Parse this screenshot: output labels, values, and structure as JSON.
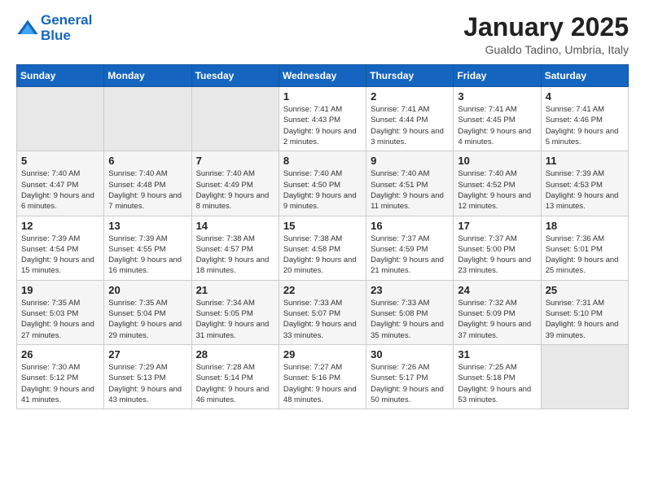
{
  "header": {
    "logo_line1": "General",
    "logo_line2": "Blue",
    "month_title": "January 2025",
    "subtitle": "Gualdo Tadino, Umbria, Italy"
  },
  "weekdays": [
    "Sunday",
    "Monday",
    "Tuesday",
    "Wednesday",
    "Thursday",
    "Friday",
    "Saturday"
  ],
  "weeks": [
    [
      {
        "day": "",
        "sunrise": "",
        "sunset": "",
        "daylight": "",
        "empty": true
      },
      {
        "day": "",
        "sunrise": "",
        "sunset": "",
        "daylight": "",
        "empty": true
      },
      {
        "day": "",
        "sunrise": "",
        "sunset": "",
        "daylight": "",
        "empty": true
      },
      {
        "day": "1",
        "sunrise": "Sunrise: 7:41 AM",
        "sunset": "Sunset: 4:43 PM",
        "daylight": "Daylight: 9 hours and 2 minutes."
      },
      {
        "day": "2",
        "sunrise": "Sunrise: 7:41 AM",
        "sunset": "Sunset: 4:44 PM",
        "daylight": "Daylight: 9 hours and 3 minutes."
      },
      {
        "day": "3",
        "sunrise": "Sunrise: 7:41 AM",
        "sunset": "Sunset: 4:45 PM",
        "daylight": "Daylight: 9 hours and 4 minutes."
      },
      {
        "day": "4",
        "sunrise": "Sunrise: 7:41 AM",
        "sunset": "Sunset: 4:46 PM",
        "daylight": "Daylight: 9 hours and 5 minutes."
      }
    ],
    [
      {
        "day": "5",
        "sunrise": "Sunrise: 7:40 AM",
        "sunset": "Sunset: 4:47 PM",
        "daylight": "Daylight: 9 hours and 6 minutes."
      },
      {
        "day": "6",
        "sunrise": "Sunrise: 7:40 AM",
        "sunset": "Sunset: 4:48 PM",
        "daylight": "Daylight: 9 hours and 7 minutes."
      },
      {
        "day": "7",
        "sunrise": "Sunrise: 7:40 AM",
        "sunset": "Sunset: 4:49 PM",
        "daylight": "Daylight: 9 hours and 8 minutes."
      },
      {
        "day": "8",
        "sunrise": "Sunrise: 7:40 AM",
        "sunset": "Sunset: 4:50 PM",
        "daylight": "Daylight: 9 hours and 9 minutes."
      },
      {
        "day": "9",
        "sunrise": "Sunrise: 7:40 AM",
        "sunset": "Sunset: 4:51 PM",
        "daylight": "Daylight: 9 hours and 11 minutes."
      },
      {
        "day": "10",
        "sunrise": "Sunrise: 7:40 AM",
        "sunset": "Sunset: 4:52 PM",
        "daylight": "Daylight: 9 hours and 12 minutes."
      },
      {
        "day": "11",
        "sunrise": "Sunrise: 7:39 AM",
        "sunset": "Sunset: 4:53 PM",
        "daylight": "Daylight: 9 hours and 13 minutes."
      }
    ],
    [
      {
        "day": "12",
        "sunrise": "Sunrise: 7:39 AM",
        "sunset": "Sunset: 4:54 PM",
        "daylight": "Daylight: 9 hours and 15 minutes."
      },
      {
        "day": "13",
        "sunrise": "Sunrise: 7:39 AM",
        "sunset": "Sunset: 4:55 PM",
        "daylight": "Daylight: 9 hours and 16 minutes."
      },
      {
        "day": "14",
        "sunrise": "Sunrise: 7:38 AM",
        "sunset": "Sunset: 4:57 PM",
        "daylight": "Daylight: 9 hours and 18 minutes."
      },
      {
        "day": "15",
        "sunrise": "Sunrise: 7:38 AM",
        "sunset": "Sunset: 4:58 PM",
        "daylight": "Daylight: 9 hours and 20 minutes."
      },
      {
        "day": "16",
        "sunrise": "Sunrise: 7:37 AM",
        "sunset": "Sunset: 4:59 PM",
        "daylight": "Daylight: 9 hours and 21 minutes."
      },
      {
        "day": "17",
        "sunrise": "Sunrise: 7:37 AM",
        "sunset": "Sunset: 5:00 PM",
        "daylight": "Daylight: 9 hours and 23 minutes."
      },
      {
        "day": "18",
        "sunrise": "Sunrise: 7:36 AM",
        "sunset": "Sunset: 5:01 PM",
        "daylight": "Daylight: 9 hours and 25 minutes."
      }
    ],
    [
      {
        "day": "19",
        "sunrise": "Sunrise: 7:35 AM",
        "sunset": "Sunset: 5:03 PM",
        "daylight": "Daylight: 9 hours and 27 minutes."
      },
      {
        "day": "20",
        "sunrise": "Sunrise: 7:35 AM",
        "sunset": "Sunset: 5:04 PM",
        "daylight": "Daylight: 9 hours and 29 minutes."
      },
      {
        "day": "21",
        "sunrise": "Sunrise: 7:34 AM",
        "sunset": "Sunset: 5:05 PM",
        "daylight": "Daylight: 9 hours and 31 minutes."
      },
      {
        "day": "22",
        "sunrise": "Sunrise: 7:33 AM",
        "sunset": "Sunset: 5:07 PM",
        "daylight": "Daylight: 9 hours and 33 minutes."
      },
      {
        "day": "23",
        "sunrise": "Sunrise: 7:33 AM",
        "sunset": "Sunset: 5:08 PM",
        "daylight": "Daylight: 9 hours and 35 minutes."
      },
      {
        "day": "24",
        "sunrise": "Sunrise: 7:32 AM",
        "sunset": "Sunset: 5:09 PM",
        "daylight": "Daylight: 9 hours and 37 minutes."
      },
      {
        "day": "25",
        "sunrise": "Sunrise: 7:31 AM",
        "sunset": "Sunset: 5:10 PM",
        "daylight": "Daylight: 9 hours and 39 minutes."
      }
    ],
    [
      {
        "day": "26",
        "sunrise": "Sunrise: 7:30 AM",
        "sunset": "Sunset: 5:12 PM",
        "daylight": "Daylight: 9 hours and 41 minutes."
      },
      {
        "day": "27",
        "sunrise": "Sunrise: 7:29 AM",
        "sunset": "Sunset: 5:13 PM",
        "daylight": "Daylight: 9 hours and 43 minutes."
      },
      {
        "day": "28",
        "sunrise": "Sunrise: 7:28 AM",
        "sunset": "Sunset: 5:14 PM",
        "daylight": "Daylight: 9 hours and 46 minutes."
      },
      {
        "day": "29",
        "sunrise": "Sunrise: 7:27 AM",
        "sunset": "Sunset: 5:16 PM",
        "daylight": "Daylight: 9 hours and 48 minutes."
      },
      {
        "day": "30",
        "sunrise": "Sunrise: 7:26 AM",
        "sunset": "Sunset: 5:17 PM",
        "daylight": "Daylight: 9 hours and 50 minutes."
      },
      {
        "day": "31",
        "sunrise": "Sunrise: 7:25 AM",
        "sunset": "Sunset: 5:18 PM",
        "daylight": "Daylight: 9 hours and 53 minutes."
      },
      {
        "day": "",
        "sunrise": "",
        "sunset": "",
        "daylight": "",
        "empty": true
      }
    ]
  ]
}
